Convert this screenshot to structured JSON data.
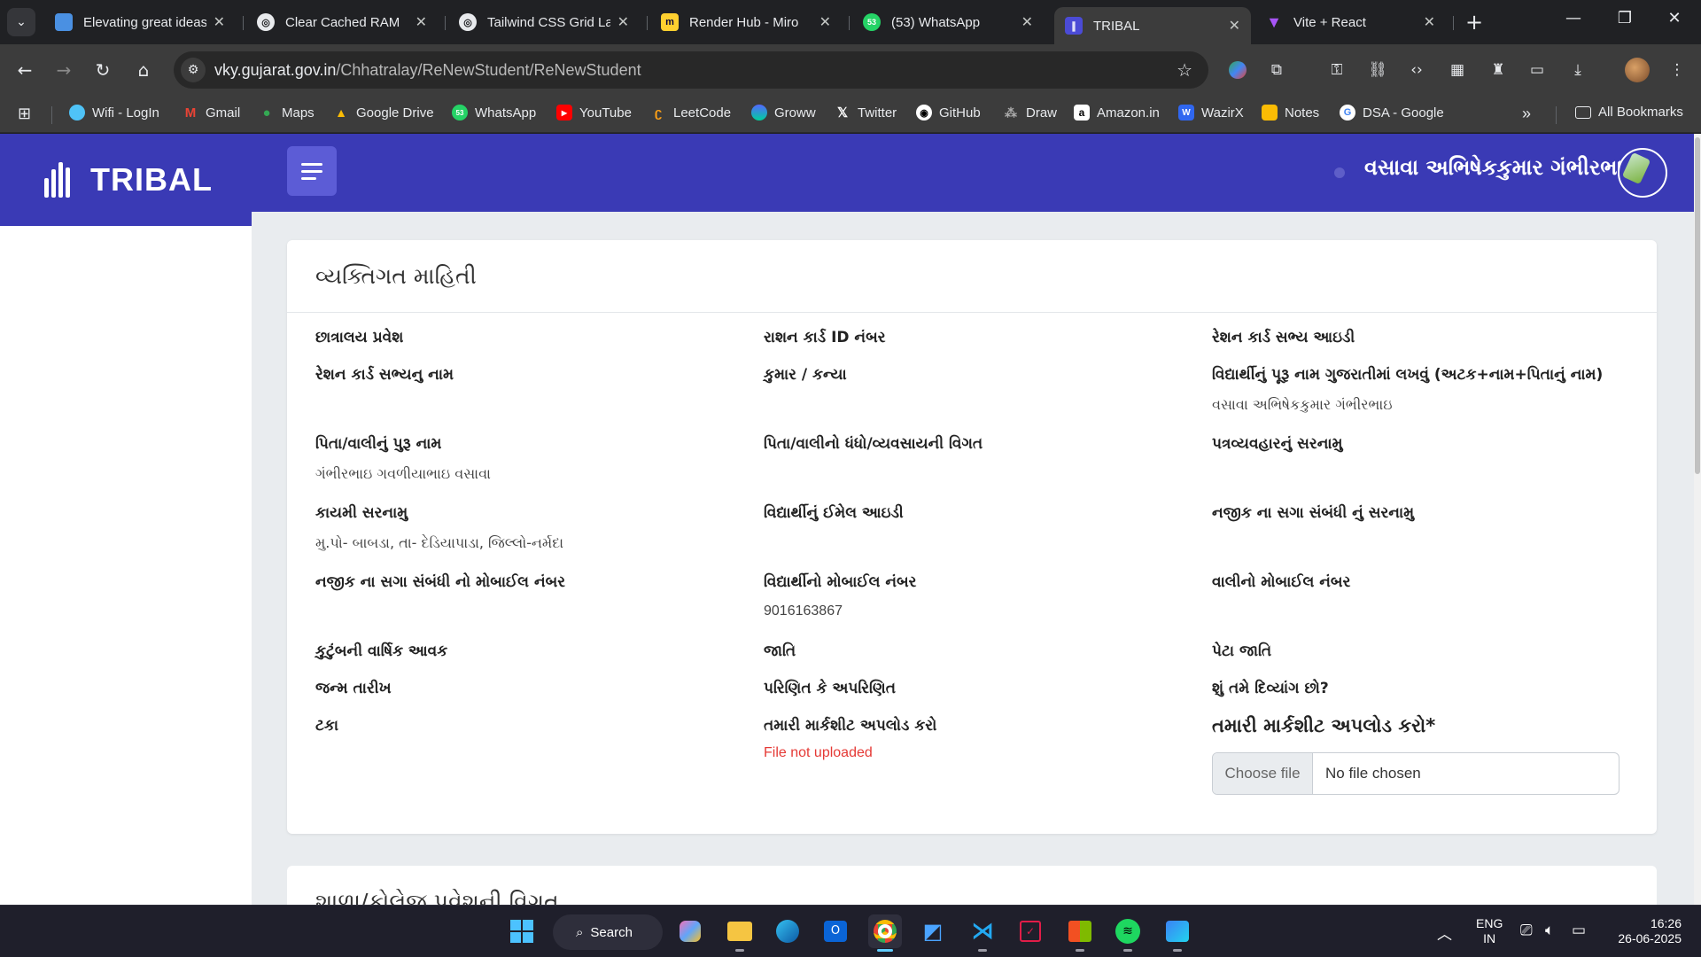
{
  "browser": {
    "tabs": [
      {
        "label": "Elevating great ideas",
        "icon": "doc-icon",
        "color": "#4a90e2"
      },
      {
        "label": "Clear Cached RAM",
        "icon": "chatgpt-icon",
        "color": "#e8eaed"
      },
      {
        "label": "Tailwind CSS Grid Lay",
        "icon": "chatgpt-icon",
        "color": "#e8eaed"
      },
      {
        "label": "Render Hub - Miro",
        "icon": "miro-icon",
        "color": "#ffd02f"
      },
      {
        "label": "(53) WhatsApp",
        "icon": "whatsapp-icon",
        "color": "#25d366"
      },
      {
        "label": "TRIBAL",
        "icon": "tribal-icon",
        "color": "#4b4bd6"
      },
      {
        "label": "Vite + React",
        "icon": "vite-icon",
        "color": "#a855f7"
      }
    ],
    "url_host": "vky.gujarat.gov.in",
    "url_path": "/Chhatralay/ReNewStudent/ReNewStudent",
    "bookmarks": [
      {
        "label": "Wifi - LogIn",
        "color": "#4fc3f7"
      },
      {
        "label": "Gmail",
        "color": "#ea4335"
      },
      {
        "label": "Maps",
        "color": "#34a853"
      },
      {
        "label": "Google Drive",
        "color": "#fbbc04"
      },
      {
        "label": "WhatsApp",
        "color": "#25d366"
      },
      {
        "label": "YouTube",
        "color": "#ff0000"
      },
      {
        "label": "LeetCode",
        "color": "#ffa116"
      },
      {
        "label": "Groww",
        "color": "#5367ff"
      },
      {
        "label": "Twitter",
        "color": "#000000"
      },
      {
        "label": "GitHub",
        "color": "#ffffff"
      },
      {
        "label": "Draw",
        "color": "#888888"
      },
      {
        "label": "Amazon.in",
        "color": "#ffffff"
      },
      {
        "label": "WazirX",
        "color": "#3067f0"
      },
      {
        "label": "Notes",
        "color": "#fbbc04"
      },
      {
        "label": "DSA - Google",
        "color": "#ffffff"
      }
    ],
    "all_bookmarks": "All Bookmarks"
  },
  "app": {
    "brand": "TRIBAL",
    "user_name": "વસાવા અભિષેકકુમાર ગંભીરભાઇ",
    "accent": "#3a3ab5"
  },
  "card": {
    "title": "વ્યક્તિગત માહિતી",
    "fields": [
      {
        "label": "છાત્રાલય પ્રવેશ",
        "value": ""
      },
      {
        "label": "રાશન કાર્ડ ID નંબર",
        "value": ""
      },
      {
        "label": "રેશન કાર્ડ સભ્ય આઇડી",
        "value": ""
      },
      {
        "label": "રેશન કાર્ડ સભ્યનુ નામ",
        "value": ""
      },
      {
        "label": "કુમાર / કન્યા",
        "value": ""
      },
      {
        "label": "વિદ્યાર્થીનું પૂરૂ નામ ગુજરાતીમાં લખવું (અટક+નામ+પિતાનું નામ)",
        "value": "વસાવા અભિષેકકુમાર ગંભીરભાઇ"
      },
      {
        "label": "પિતા/વાલીનું પુરૂ નામ",
        "value": "ગંભીરભાઇ ગવળીયાભાઇ વસાવા"
      },
      {
        "label": "પિતા/વાલીનો ધંધો/વ્યવસાયની વિગત",
        "value": ""
      },
      {
        "label": "પત્રવ્યવહારનું સરનામુ",
        "value": ""
      },
      {
        "label": "કાયમી સરનામુ",
        "value": "મુ.પો- બાબડા, તા- દેડિયાપાડા, જિલ્લો-નર્મદા"
      },
      {
        "label": "વિદ્યાર્થીનું ઈમેલ આઇડી",
        "value": ""
      },
      {
        "label": "નજીક ના સગા સંબંધી નું સરનામુ",
        "value": ""
      },
      {
        "label": "નજીક ના સગા સંબંધી નો મોબાઈલ નંબર",
        "value": ""
      },
      {
        "label": "વિદ્યાર્થીનો મોબાઈલ નંબર",
        "value": "9016163867"
      },
      {
        "label": "વાલીનો મોબાઈલ નંબર",
        "value": ""
      },
      {
        "label": "કુટુંબની વાર્ષિક આવક",
        "value": ""
      },
      {
        "label": "જાતિ",
        "value": ""
      },
      {
        "label": "પેટા જાતિ",
        "value": ""
      },
      {
        "label": "જન્મ તારીખ",
        "value": ""
      },
      {
        "label": "પરિણિત કે અપરિણિત",
        "value": ""
      },
      {
        "label": "શું તમે દિવ્યાંગ છો?",
        "value": ""
      },
      {
        "label": "ટકા",
        "value": ""
      },
      {
        "label": "તમારી માર્કશીટ અપલોડ કરો",
        "value": "File not uploaded"
      }
    ],
    "upload": {
      "label": "તમારી માર્કશીટ અપલોડ કરો*",
      "button": "Choose file",
      "status": "No file chosen"
    }
  },
  "card2": {
    "title": "શાળા/કોલેજ પ્રવેશની વિગત"
  },
  "taskbar": {
    "search": "Search",
    "lang_line1": "ENG",
    "lang_line2": "IN",
    "time": "16:26",
    "date": "26-06-2025"
  }
}
